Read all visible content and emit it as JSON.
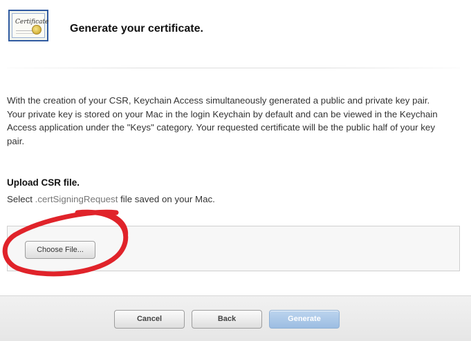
{
  "header": {
    "icon_name": "certificate-icon",
    "icon_text": "Certificate",
    "title": "Generate your certificate."
  },
  "body": {
    "paragraph": "With the creation of your CSR, Keychain Access simultaneously generated a public and private key pair. Your private key is stored on your Mac in the login Keychain by default and can be viewed in the Keychain Access application under the \"Keys\" category. Your requested certificate will be the public half of your key pair."
  },
  "upload": {
    "heading": "Upload CSR file.",
    "desc_prefix": "Select ",
    "desc_ext": ".certSigningRequest",
    "desc_suffix": " file saved on your Mac.",
    "choose_label": "Choose File..."
  },
  "footer": {
    "cancel_label": "Cancel",
    "back_label": "Back",
    "generate_label": "Generate"
  },
  "colors": {
    "annotation": "#e0232a",
    "generate_disabled": "#a9c6e8",
    "certificate_border": "#2f5aa0"
  }
}
